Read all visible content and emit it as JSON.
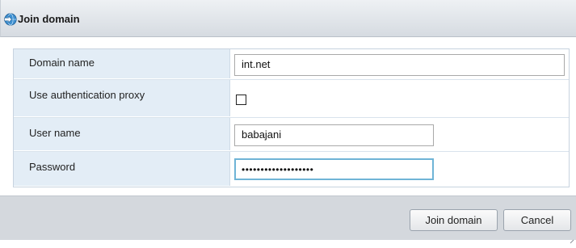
{
  "dialog": {
    "title": "Join domain",
    "icon": "join-domain-icon"
  },
  "form": {
    "domain_name": {
      "label": "Domain name",
      "value": "int.net"
    },
    "use_auth_proxy": {
      "label": "Use authentication proxy",
      "checked": false
    },
    "user_name": {
      "label": "User name",
      "value": "babajani"
    },
    "password": {
      "label": "Password",
      "masked_value": "•••••••••••••••••••"
    }
  },
  "buttons": {
    "join_label": "Join domain",
    "cancel_label": "Cancel"
  },
  "colors": {
    "label_background": "#e3edf6",
    "footer_background": "#d4d8dd",
    "focus_border": "#6fb4d6"
  }
}
